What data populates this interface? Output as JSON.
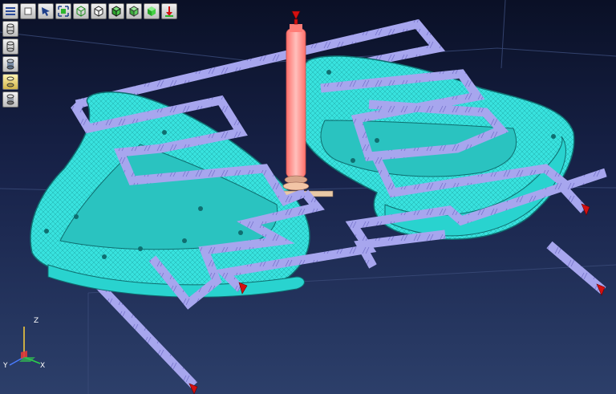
{
  "toolbar": {
    "buttons": [
      {
        "icon": "menu-icon"
      },
      {
        "icon": "view-front-icon"
      },
      {
        "icon": "select-arrow-icon"
      },
      {
        "icon": "fit-view-icon"
      },
      {
        "icon": "wireframe-cube-icon"
      },
      {
        "icon": "hidden-line-cube-icon"
      },
      {
        "icon": "shaded-edges-cube-icon"
      },
      {
        "icon": "shaded-outline-cube-icon"
      },
      {
        "icon": "shaded-solid-cube-icon"
      },
      {
        "icon": "load-arrow-icon"
      }
    ]
  },
  "side_toolbar": {
    "buttons": [
      {
        "icon": "cylinder-outline-icon",
        "active": false
      },
      {
        "icon": "cylinder-edges-icon",
        "active": false
      },
      {
        "icon": "cylinder-shaded-icon",
        "active": false
      },
      {
        "icon": "cylinder-highlight-icon",
        "active": true
      },
      {
        "icon": "cylinder-solid-icon",
        "active": false
      }
    ]
  },
  "axis_triad": {
    "x_label": "X",
    "y_label": "Y",
    "z_label": "Z"
  },
  "colors": {
    "mesh": "#33e0dc",
    "mesh_edge": "#0f6e70",
    "beam": "#a9a8ef",
    "actuator": "#ff8a86",
    "load_marker": "#d41010"
  }
}
